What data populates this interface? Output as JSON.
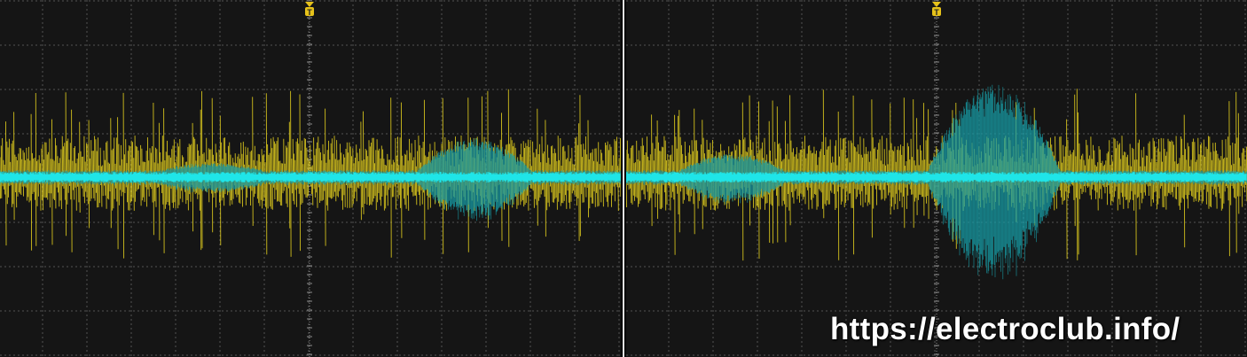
{
  "watermark": {
    "text": "https://electroclub.info/"
  },
  "colors": {
    "background": "#151515",
    "grid": "#6a6a6a",
    "channel1": "#e6d21e",
    "channel2": "#1fe5e8",
    "channel2_dim": "#179aa3",
    "trigger_marker": "#e6c21a"
  },
  "screens": [
    {
      "name": "left-capture",
      "trigger_marker": "T",
      "channels": [
        "CH1",
        "CH2"
      ]
    },
    {
      "name": "right-capture",
      "trigger_marker": "T",
      "channels": [
        "CH1",
        "CH2"
      ]
    }
  ]
}
